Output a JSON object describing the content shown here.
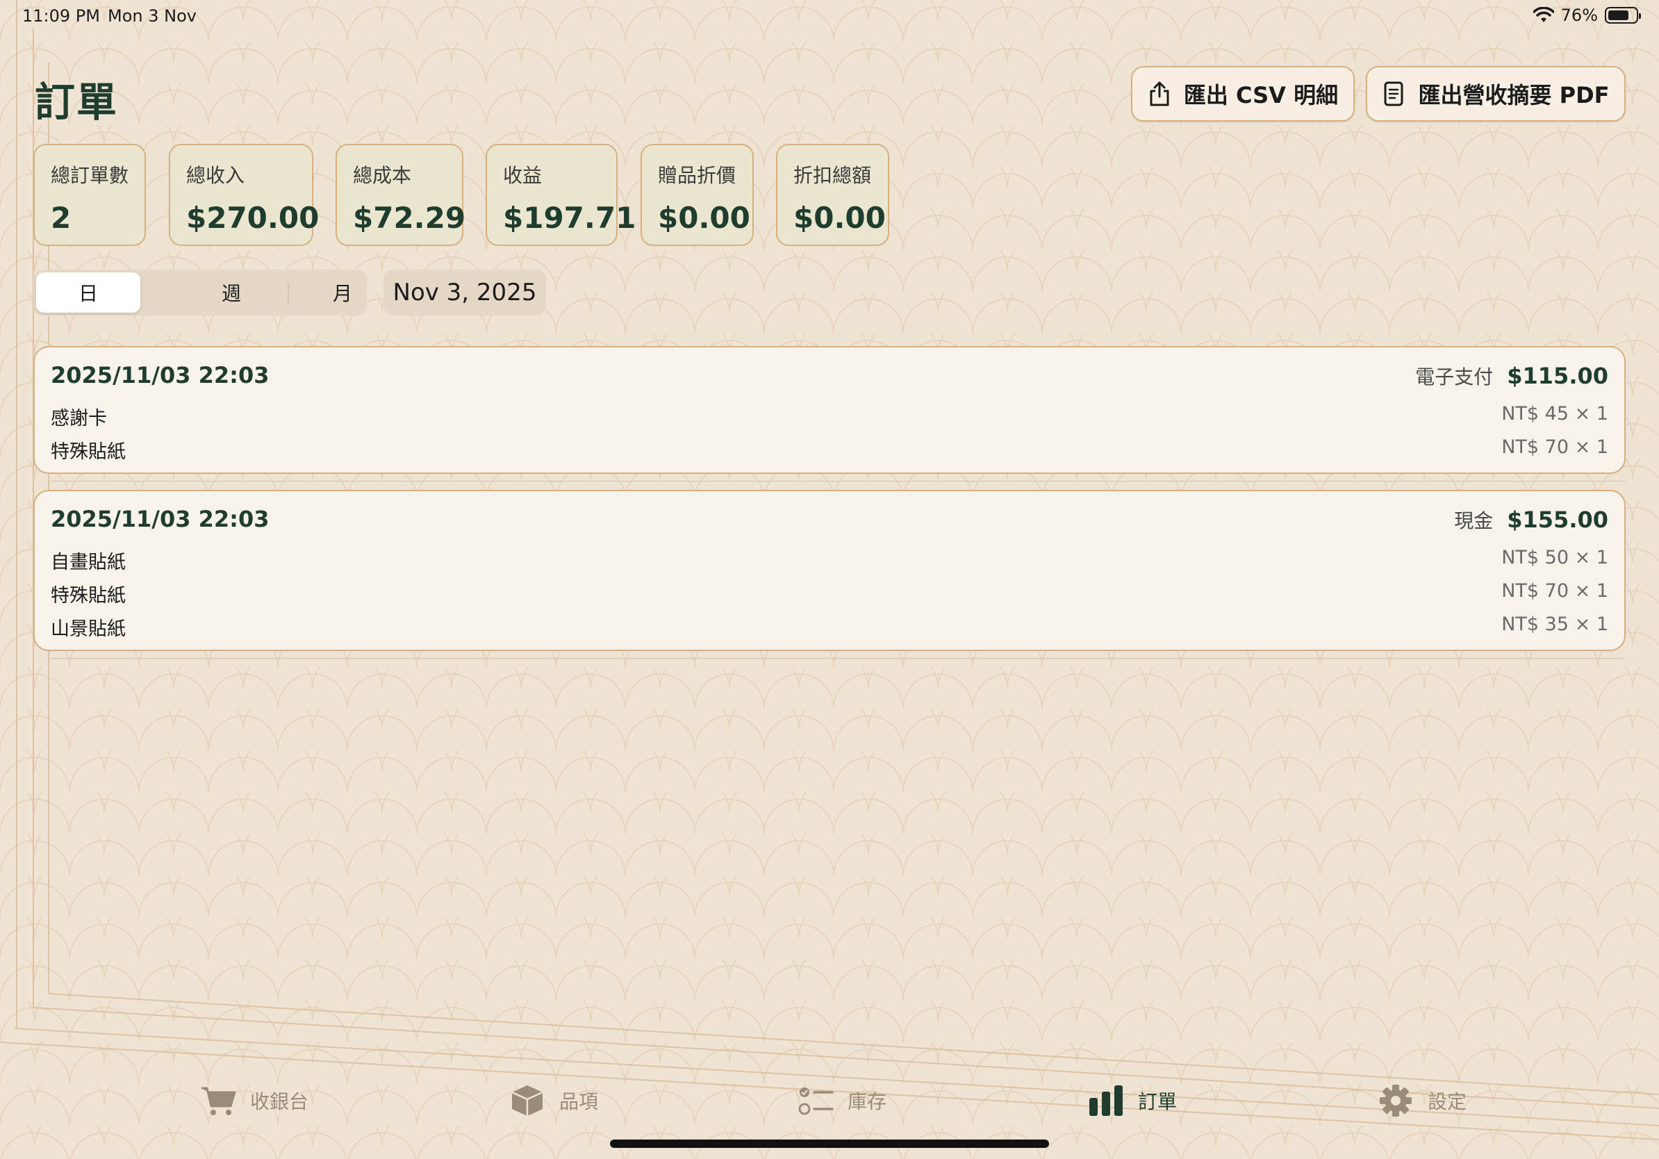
{
  "status_bar": {
    "time": "11:09 PM",
    "date": "Mon 3 Nov",
    "battery": "76%",
    "battery_level": 0.76
  },
  "page": {
    "title": "訂單"
  },
  "toolbar": {
    "export_csv_label": "匯出 CSV 明細",
    "export_pdf_label": "匯出營收摘要 PDF"
  },
  "stats": [
    {
      "label": "總訂單數",
      "value": "2"
    },
    {
      "label": "總收入",
      "value": "$270.00"
    },
    {
      "label": "總成本",
      "value": "$72.29"
    },
    {
      "label": "收益",
      "value": "$197.71"
    },
    {
      "label": "贈品折價",
      "value": "$0.00"
    },
    {
      "label": "折扣總額",
      "value": "$0.00"
    }
  ],
  "period": {
    "options": [
      "日",
      "週",
      "月"
    ],
    "selected": "日",
    "date": "Nov 3, 2025"
  },
  "orders": [
    {
      "time": "2025/11/03 22:03",
      "payment": "電子支付",
      "total": "$115.00",
      "items": [
        {
          "name": "感謝卡",
          "qty": "NT$ 45 × 1"
        },
        {
          "name": "特殊貼紙",
          "qty": "NT$ 70 × 1"
        }
      ]
    },
    {
      "time": "2025/11/03 22:03",
      "payment": "現金",
      "total": "$155.00",
      "items": [
        {
          "name": "自畫貼紙",
          "qty": "NT$ 50 × 1"
        },
        {
          "name": "特殊貼紙",
          "qty": "NT$ 70 × 1"
        },
        {
          "name": "山景貼紙",
          "qty": "NT$ 35 × 1"
        }
      ]
    }
  ],
  "tabs": [
    {
      "label": "收銀台",
      "icon": "cart-icon"
    },
    {
      "label": "品項",
      "icon": "box-icon"
    },
    {
      "label": "庫存",
      "icon": "checklist-icon"
    },
    {
      "label": "訂單",
      "icon": "bar-chart-icon",
      "active": true
    },
    {
      "label": "設定",
      "icon": "gear-icon"
    }
  ],
  "colors": {
    "background": "#efe3d3",
    "accent": "#1f3d2e",
    "card_border": "#d6b07e",
    "stat_card_bg": "#ebe6cf",
    "inactive_tab": "#9a8c78"
  }
}
